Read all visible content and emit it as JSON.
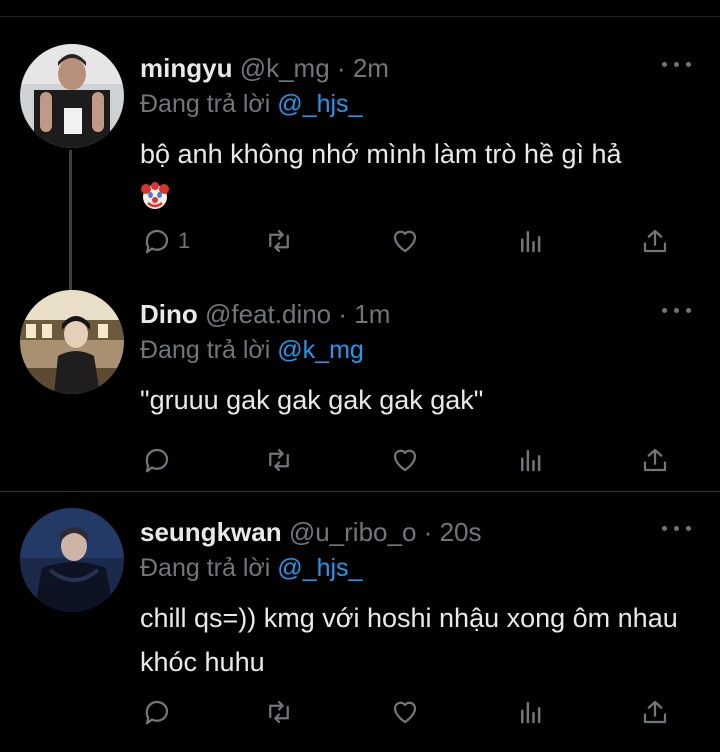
{
  "tweets": [
    {
      "name": "mingyu",
      "handle": "@k_mg",
      "separator": "·",
      "time": "2m",
      "replying_prefix": "Đang trả lời",
      "replying_to": "@_hjs_",
      "text": "bộ anh không nhớ mình làm trò hề gì hả",
      "emoji": "clown-face-icon",
      "reply_count": "1"
    },
    {
      "name": "Dino",
      "handle": "@feat.dino",
      "separator": "·",
      "time": "1m",
      "replying_prefix": "Đang trả lời",
      "replying_to": "@k_mg",
      "text": "\"gruuu gak gak gak gak gak\"",
      "reply_count": ""
    },
    {
      "name": "seungkwan",
      "handle": "@u_ribo_o",
      "separator": "·",
      "time": "20s",
      "replying_prefix": "Đang trả lời",
      "replying_to": "@_hjs_",
      "text": "chill qs=)) kmg với hoshi nhậu xong ôm nhau khóc huhu",
      "reply_count": ""
    }
  ],
  "colors": {
    "background": "#000000",
    "text": "#e7e9ea",
    "secondary": "#71767b",
    "mention": "#1d9bf0",
    "divider": "#2f3336"
  }
}
